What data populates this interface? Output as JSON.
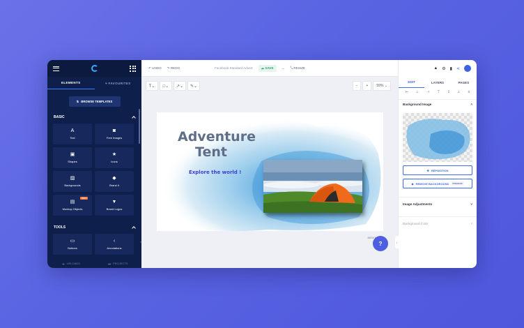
{
  "sidebar": {
    "tabs": [
      {
        "label": "ELEMENTS"
      },
      {
        "label": "FAVOURITES"
      }
    ],
    "browse_label": "BROWSE TEMPLATES",
    "basic_header": "BASIC",
    "tools_header": "TOOLS",
    "tiles": [
      {
        "label": "Text",
        "icon": "text-icon"
      },
      {
        "label": "Free Images",
        "icon": "camera-icon"
      },
      {
        "label": "Shapes",
        "icon": "shapes-icon"
      },
      {
        "label": "Icons",
        "icon": "star-icon"
      },
      {
        "label": "Backgrounds",
        "icon": "backgrounds-icon"
      },
      {
        "label": "Brand it",
        "icon": "tag-icon"
      },
      {
        "label": "Mockup Objects",
        "icon": "mockup-icon",
        "badge": "NEW"
      },
      {
        "label": "Brand Logos",
        "icon": "logo-icon"
      }
    ],
    "tools_tiles": [
      {
        "label": "Buttons",
        "icon": "button-icon"
      },
      {
        "label": "Annotations",
        "icon": "annotation-icon"
      }
    ],
    "bottom": [
      {
        "label": "UPLOADS"
      },
      {
        "label": "PROJECTS"
      }
    ]
  },
  "topbar": {
    "undo": "UNDO",
    "redo": "REDO",
    "doc_title": "Facebook Standard Advert",
    "save": "SAVE",
    "resize": "RESIZE"
  },
  "zoom": {
    "level": "59%"
  },
  "canvas": {
    "headline_1": "Adventure",
    "headline_2": "Tent",
    "tagline": "Explore the world !",
    "new_page": "NEW PAGE"
  },
  "help_label": "?",
  "right": {
    "tabs": [
      {
        "label": "EDIT"
      },
      {
        "label": "LAYERS"
      },
      {
        "label": "PAGES"
      }
    ],
    "bg_image_header": "Background Image",
    "reposition": "REPOSITION",
    "remove_bg": "REMOVE BACKGROUND",
    "premium": "PREMIUM",
    "image_adjustments": "Image Adjustments",
    "background_color": "Background Color"
  },
  "colors": {
    "sidebar": "#0f1f4b",
    "accent": "#3e6be6",
    "headline": "#5f6f8a",
    "tagline": "#3b3fd9"
  }
}
